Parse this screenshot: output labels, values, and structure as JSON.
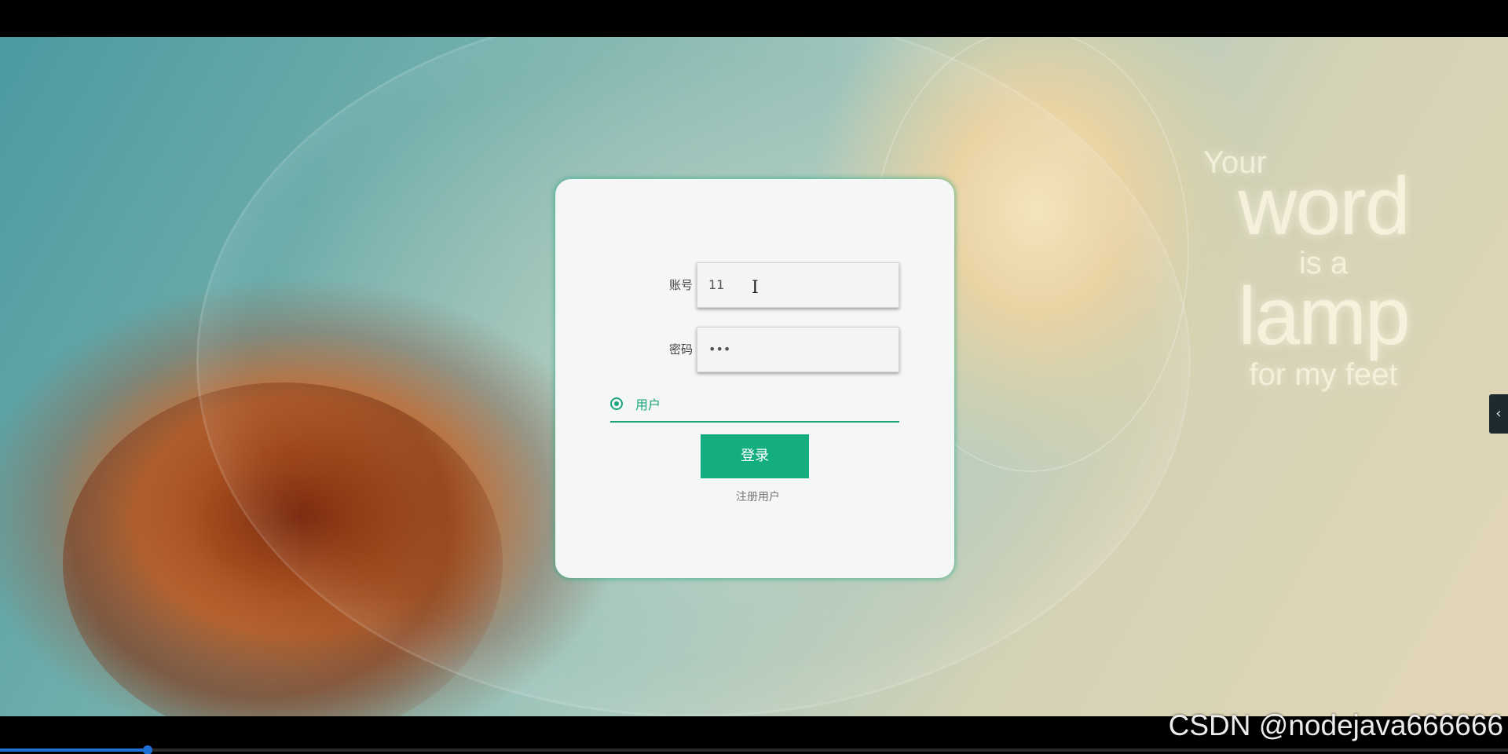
{
  "login": {
    "account_label": "账号",
    "account_value": "11",
    "password_label": "密码",
    "password_value": "•••",
    "role_option": "用户",
    "login_button": "登录",
    "register_link": "注册用户"
  },
  "background_quote": {
    "line1": "Your",
    "line2": "word",
    "line3": "is a",
    "line4": "lamp",
    "line5": "for my feet"
  },
  "side_toggle": "‹",
  "video_player": {
    "progress_percent": 9.8
  },
  "watermark": "CSDN @nodejava666666",
  "colors": {
    "accent": "#13ad80",
    "progress": "#1e6fd6"
  },
  "icons": {
    "side_toggle_icon": "chevron-left-icon",
    "radio_icon": "radio-selected-icon"
  }
}
